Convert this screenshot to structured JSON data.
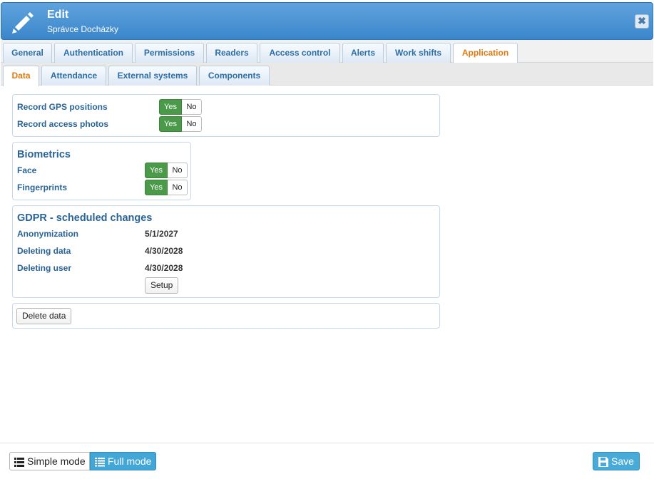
{
  "header": {
    "title": "Edit",
    "subtitle": "Správce Docházky",
    "close_symbol": "✖"
  },
  "tabs": [
    {
      "label": "General"
    },
    {
      "label": "Authentication"
    },
    {
      "label": "Permissions"
    },
    {
      "label": "Readers"
    },
    {
      "label": "Access control"
    },
    {
      "label": "Alerts"
    },
    {
      "label": "Work shifts"
    },
    {
      "label": "Application",
      "active": true
    }
  ],
  "subtabs": [
    {
      "label": "Data",
      "active": true
    },
    {
      "label": "Attendance"
    },
    {
      "label": "External systems"
    },
    {
      "label": "Components"
    }
  ],
  "record": {
    "gps_label": "Record GPS positions",
    "photos_label": "Record access photos",
    "yes": "Yes",
    "no": "No"
  },
  "biometrics": {
    "title": "Biometrics",
    "face_label": "Face",
    "fingerprints_label": "Fingerprints"
  },
  "gdpr": {
    "title": "GDPR - scheduled changes",
    "rows": [
      {
        "label": "Anonymization",
        "value": "5/1/2027"
      },
      {
        "label": "Deleting data",
        "value": "4/30/2028"
      },
      {
        "label": "Deleting user",
        "value": "4/30/2028"
      }
    ],
    "setup_label": "Setup"
  },
  "delete_data_label": "Delete data",
  "footer": {
    "simple_mode": "Simple mode",
    "full_mode": "Full mode",
    "save": "Save"
  },
  "colors": {
    "header": "#3b86cb",
    "active_tab_text": "#e07a10",
    "toggle_yes": "#4a9a4a",
    "primary_button": "#42a7d6"
  },
  "icons": [
    "pencil-icon",
    "close-icon",
    "list-icon",
    "floppy-disk-icon"
  ]
}
